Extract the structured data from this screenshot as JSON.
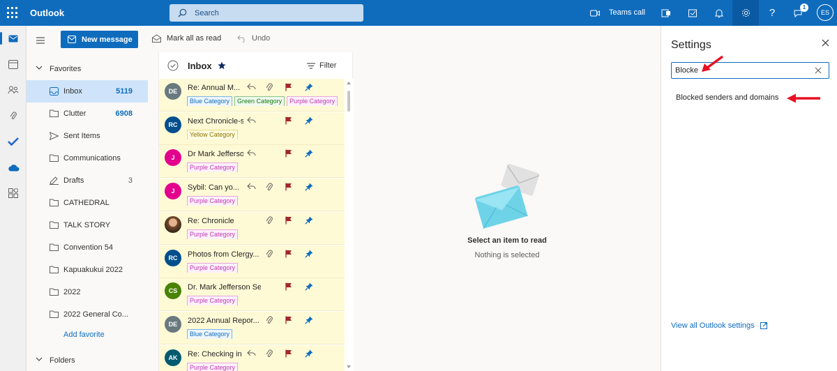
{
  "app": {
    "name": "Outlook"
  },
  "search": {
    "placeholder": "Search"
  },
  "topbar": {
    "teams_call": "Teams call",
    "notification_badge": "1",
    "user_initials": "ES"
  },
  "commands": {
    "new_message": "New message",
    "mark_all_read": "Mark all as read",
    "undo": "Undo"
  },
  "favorites": {
    "header": "Favorites",
    "items": [
      {
        "label": "Inbox",
        "count": "5119"
      },
      {
        "label": "Clutter",
        "count": "6908"
      },
      {
        "label": "Sent Items",
        "count": ""
      },
      {
        "label": "Communications",
        "count": ""
      },
      {
        "label": "Drafts",
        "count": "3"
      },
      {
        "label": "CATHEDRAL",
        "count": ""
      },
      {
        "label": "TALK STORY",
        "count": ""
      },
      {
        "label": "Convention 54",
        "count": ""
      },
      {
        "label": "Kapuakukui 2022",
        "count": ""
      },
      {
        "label": "2022",
        "count": ""
      },
      {
        "label": "2022 General Co...",
        "count": ""
      }
    ],
    "add_favorite": "Add favorite"
  },
  "folders_header": "Folders",
  "message_list": {
    "title": "Inbox",
    "filter_label": "Filter",
    "messages": [
      {
        "initials": "DE",
        "avatar_color": "#69797e",
        "subject": "Re: Annual M...",
        "icons": [
          "reply",
          "attach",
          "flag",
          "pin"
        ],
        "categories": [
          {
            "label": "Blue Category",
            "style": "blue"
          },
          {
            "label": "Green Category",
            "style": "green"
          },
          {
            "label": "Purple Category",
            "style": "purple"
          }
        ]
      },
      {
        "initials": "RC",
        "avatar_color": "#004e8c",
        "subject": "Next Chronicle-sca...",
        "icons": [
          "reply",
          "flag",
          "pin"
        ],
        "categories": [
          {
            "label": "Yellow Category",
            "style": "yellow"
          }
        ]
      },
      {
        "initials": "J",
        "avatar_color": "#e3008c",
        "subject": "Dr Mark Jefferson a...",
        "icons": [
          "reply",
          "flag",
          "pin"
        ],
        "categories": [
          {
            "label": "Purple Category",
            "style": "purple"
          }
        ]
      },
      {
        "initials": "J",
        "avatar_color": "#e3008c",
        "subject": "Sybil: Can yo...",
        "icons": [
          "reply",
          "attach",
          "flag",
          "pin"
        ],
        "categories": [
          {
            "label": "Purple Category",
            "style": "purple"
          }
        ]
      },
      {
        "initials": "",
        "avatar_color": "photo",
        "subject": "Re: Chronicle",
        "icons": [
          "attach",
          "flag",
          "pin"
        ],
        "categories": [
          {
            "label": "Purple Category",
            "style": "purple"
          }
        ]
      },
      {
        "initials": "RC",
        "avatar_color": "#004e8c",
        "subject": "Photos from Clergy...",
        "icons": [
          "attach",
          "flag",
          "pin"
        ],
        "categories": [
          {
            "label": "Purple Category",
            "style": "purple"
          }
        ]
      },
      {
        "initials": "CS",
        "avatar_color": "#498205",
        "subject": "Dr. Mark Jefferson Serm...",
        "icons": [
          "flag",
          "pin"
        ],
        "categories": [
          {
            "label": "Purple Category",
            "style": "purple"
          }
        ]
      },
      {
        "initials": "DE",
        "avatar_color": "#69797e",
        "subject": "2022 Annual Repor...",
        "icons": [
          "attach",
          "flag",
          "pin"
        ],
        "categories": [
          {
            "label": "Blue Category",
            "style": "blue"
          }
        ]
      },
      {
        "initials": "AK",
        "avatar_color": "#005b70",
        "subject": "Re: Checking in re ...",
        "icons": [
          "reply",
          "attach",
          "flag",
          "pin"
        ],
        "categories": [
          {
            "label": "Purple Category",
            "style": "purple"
          }
        ]
      }
    ]
  },
  "reading_pane": {
    "empty_title": "Select an item to read",
    "empty_subtitle": "Nothing is selected"
  },
  "settings": {
    "title": "Settings",
    "search_value": "Blocke",
    "result": "Blocked senders and domains",
    "view_all": "View all Outlook settings"
  },
  "colors": {
    "brand": "#0f6cbd",
    "flag": "#a4262c",
    "pin": "#0f6cbd",
    "unread_bg": "#fffad6",
    "annotation_arrow": "#e81123"
  }
}
